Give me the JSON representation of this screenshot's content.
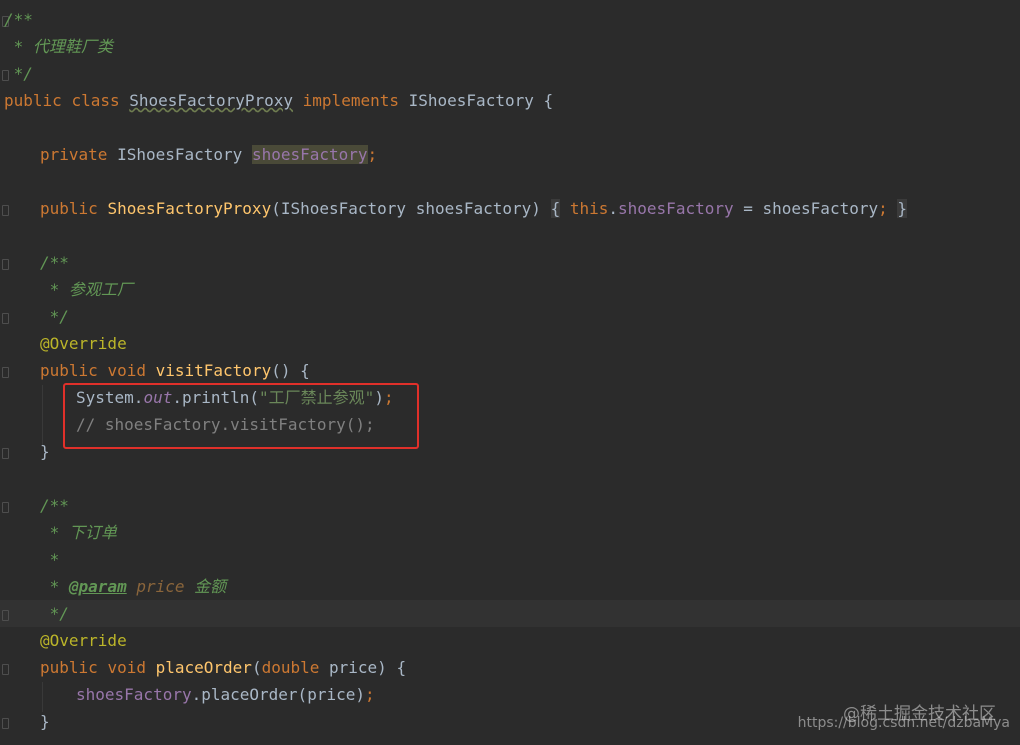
{
  "code": {
    "l1": "/**",
    "l2": " * 代理鞋厂类",
    "l3": " */",
    "l4_kw1": "public",
    "l4_kw2": "class",
    "l4_name": "ShoesFactoryProxy",
    "l4_kw3": "implements",
    "l4_iface": "IShoesFactory {",
    "l6_kw": "private",
    "l6_type": "IShoesFactory",
    "l6_field": "shoesFactory",
    "l6_semi": ";",
    "l8_kw": "public",
    "l8_ctor": "ShoesFactoryProxy",
    "l8_params": "(IShoesFactory shoesFactory)",
    "l8_open": "{",
    "l8_this": "this",
    "l8_dot": ".",
    "l8_field": "shoesFactory",
    "l8_assign": " = shoesFactory",
    "l8_semi": ";",
    "l8_close": "}",
    "l10": "/**",
    "l11": " * 参观工厂",
    "l12": " */",
    "l13": "@Override",
    "l14_kw1": "public",
    "l14_kw2": "void",
    "l14_name": "visitFactory",
    "l14_rest": "() {",
    "l15_sys": "System.",
    "l15_out": "out",
    "l15_call": ".println(",
    "l15_str": "\"工厂禁止参观\"",
    "l15_close": ")",
    "l15_semi": ";",
    "l16": "// shoesFactory.visitFactory();",
    "l17": "}",
    "l19": "/**",
    "l20": " * 下订单",
    "l21": " *",
    "l22_star": " * ",
    "l22_tag": "@param",
    "l22_name": "price",
    "l22_desc": " 金额",
    "l23": " */",
    "l24": "@Override",
    "l25_kw1": "public",
    "l25_kw2": "void",
    "l25_name": "placeOrder",
    "l25_open": "(",
    "l25_type": "double",
    "l25_rest": " price) {",
    "l26_field": "shoesFactory",
    "l26_call": ".placeOrder(price)",
    "l26_semi": ";",
    "l27": "}"
  },
  "watermark": {
    "brand": "@稀土掘金技术社区",
    "url": "https://blog.csdn.net/dzbaMya"
  }
}
